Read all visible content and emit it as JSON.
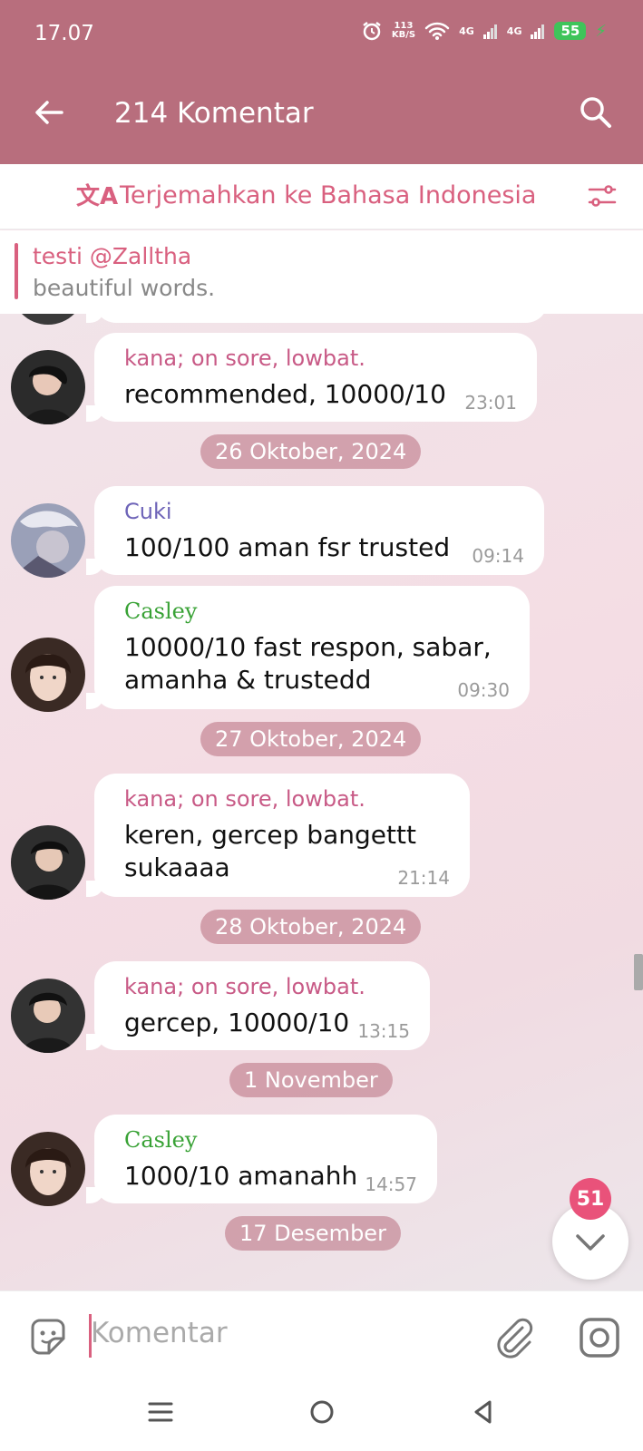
{
  "status": {
    "time": "17.07",
    "speed_value": "113",
    "speed_unit": "KB/S",
    "net1": "4G",
    "net2": "4G",
    "battery": "55"
  },
  "header": {
    "title": "214 Komentar"
  },
  "translate": {
    "label": "Terjemahkan ke Bahasa Indonesia"
  },
  "pinned": {
    "title": "testi @Zalltha",
    "text": "beautiful words."
  },
  "messages": [
    {
      "name": "kana; on sore, lowbat.",
      "text": "recommended, 10000/10",
      "time": "23:01"
    },
    {
      "date": "26 Oktober, 2024"
    },
    {
      "name": "Cuki",
      "text": "100/100 aman fsr trusted",
      "time": "09:14"
    },
    {
      "name": "Casley",
      "text": "10000/10 fast respon, sabar,\namanha & trustedd",
      "time": "09:30"
    },
    {
      "date": "27 Oktober, 2024"
    },
    {
      "name": "kana; on sore, lowbat.",
      "text": "keren, gercep bangettt\nsukaaaa",
      "time": "21:14"
    },
    {
      "date": "28 Oktober, 2024"
    },
    {
      "name": "kana; on sore, lowbat.",
      "text": "gercep, 10000/10",
      "time": "13:15"
    },
    {
      "date": "1 November"
    },
    {
      "name": "Casley",
      "text": "1000/10 amanahh",
      "time": "14:57"
    },
    {
      "date": "17 Desember"
    }
  ],
  "scroll_badge": "51",
  "input": {
    "placeholder": "Komentar"
  },
  "colors": {
    "appbar": "#b86e7d",
    "accent": "#d9607f",
    "badge": "#e9527a"
  },
  "icons": [
    "back-arrow-icon",
    "search-icon",
    "translate-icon",
    "filter-icon",
    "chevron-down-icon",
    "sticker-icon",
    "paperclip-icon",
    "camera-icon",
    "nav-menu-icon",
    "nav-home-icon",
    "nav-back-icon"
  ]
}
